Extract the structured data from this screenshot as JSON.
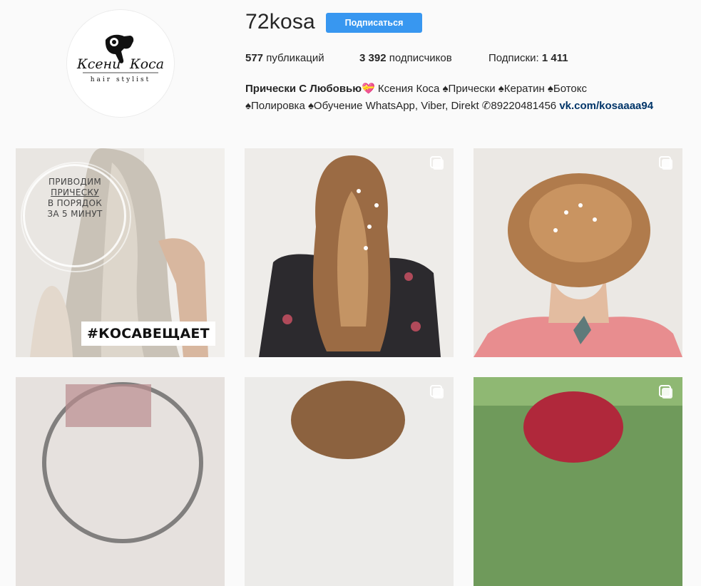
{
  "profile": {
    "username": "72kosa",
    "follow_label": "Подписаться",
    "logo": {
      "line1_left": "Ксени",
      "line1_right": "Коса",
      "line2": "hair stylist"
    },
    "stats": {
      "posts_count": "577",
      "posts_label": "публикаций",
      "followers_count": "3 392",
      "followers_label": "подписчиков",
      "following_label": "Подписки:",
      "following_count": "1 411"
    },
    "bio": {
      "name": "Прически С Любовью💝",
      "line1_rest": " Ксения Коса ♠Прически ♠Кератин ♠Ботокс",
      "line2": "♠Полировка ♠Обучение WhatsApp, Viber, Direkt ✆89220481456 ",
      "link": "vk.com/kosaaaa94"
    }
  },
  "posts": [
    {
      "overlay_line1": "ПРИВОДИМ",
      "overlay_line2": "ПРИЧЕСКУ",
      "overlay_line3": "В ПОРЯДОК",
      "overlay_line4": "ЗА 5 МИНУТ",
      "hashtag": "#КОСАВЕЩАЕТ",
      "multi": false
    },
    {
      "multi": true
    },
    {
      "multi": true
    },
    {
      "multi": false
    },
    {
      "multi": true
    },
    {
      "multi": true
    }
  ],
  "colors": {
    "accent": "#3897f0",
    "link": "#003569",
    "background": "#fafafa"
  },
  "icons": {
    "multi_post": "carousel-icon"
  }
}
